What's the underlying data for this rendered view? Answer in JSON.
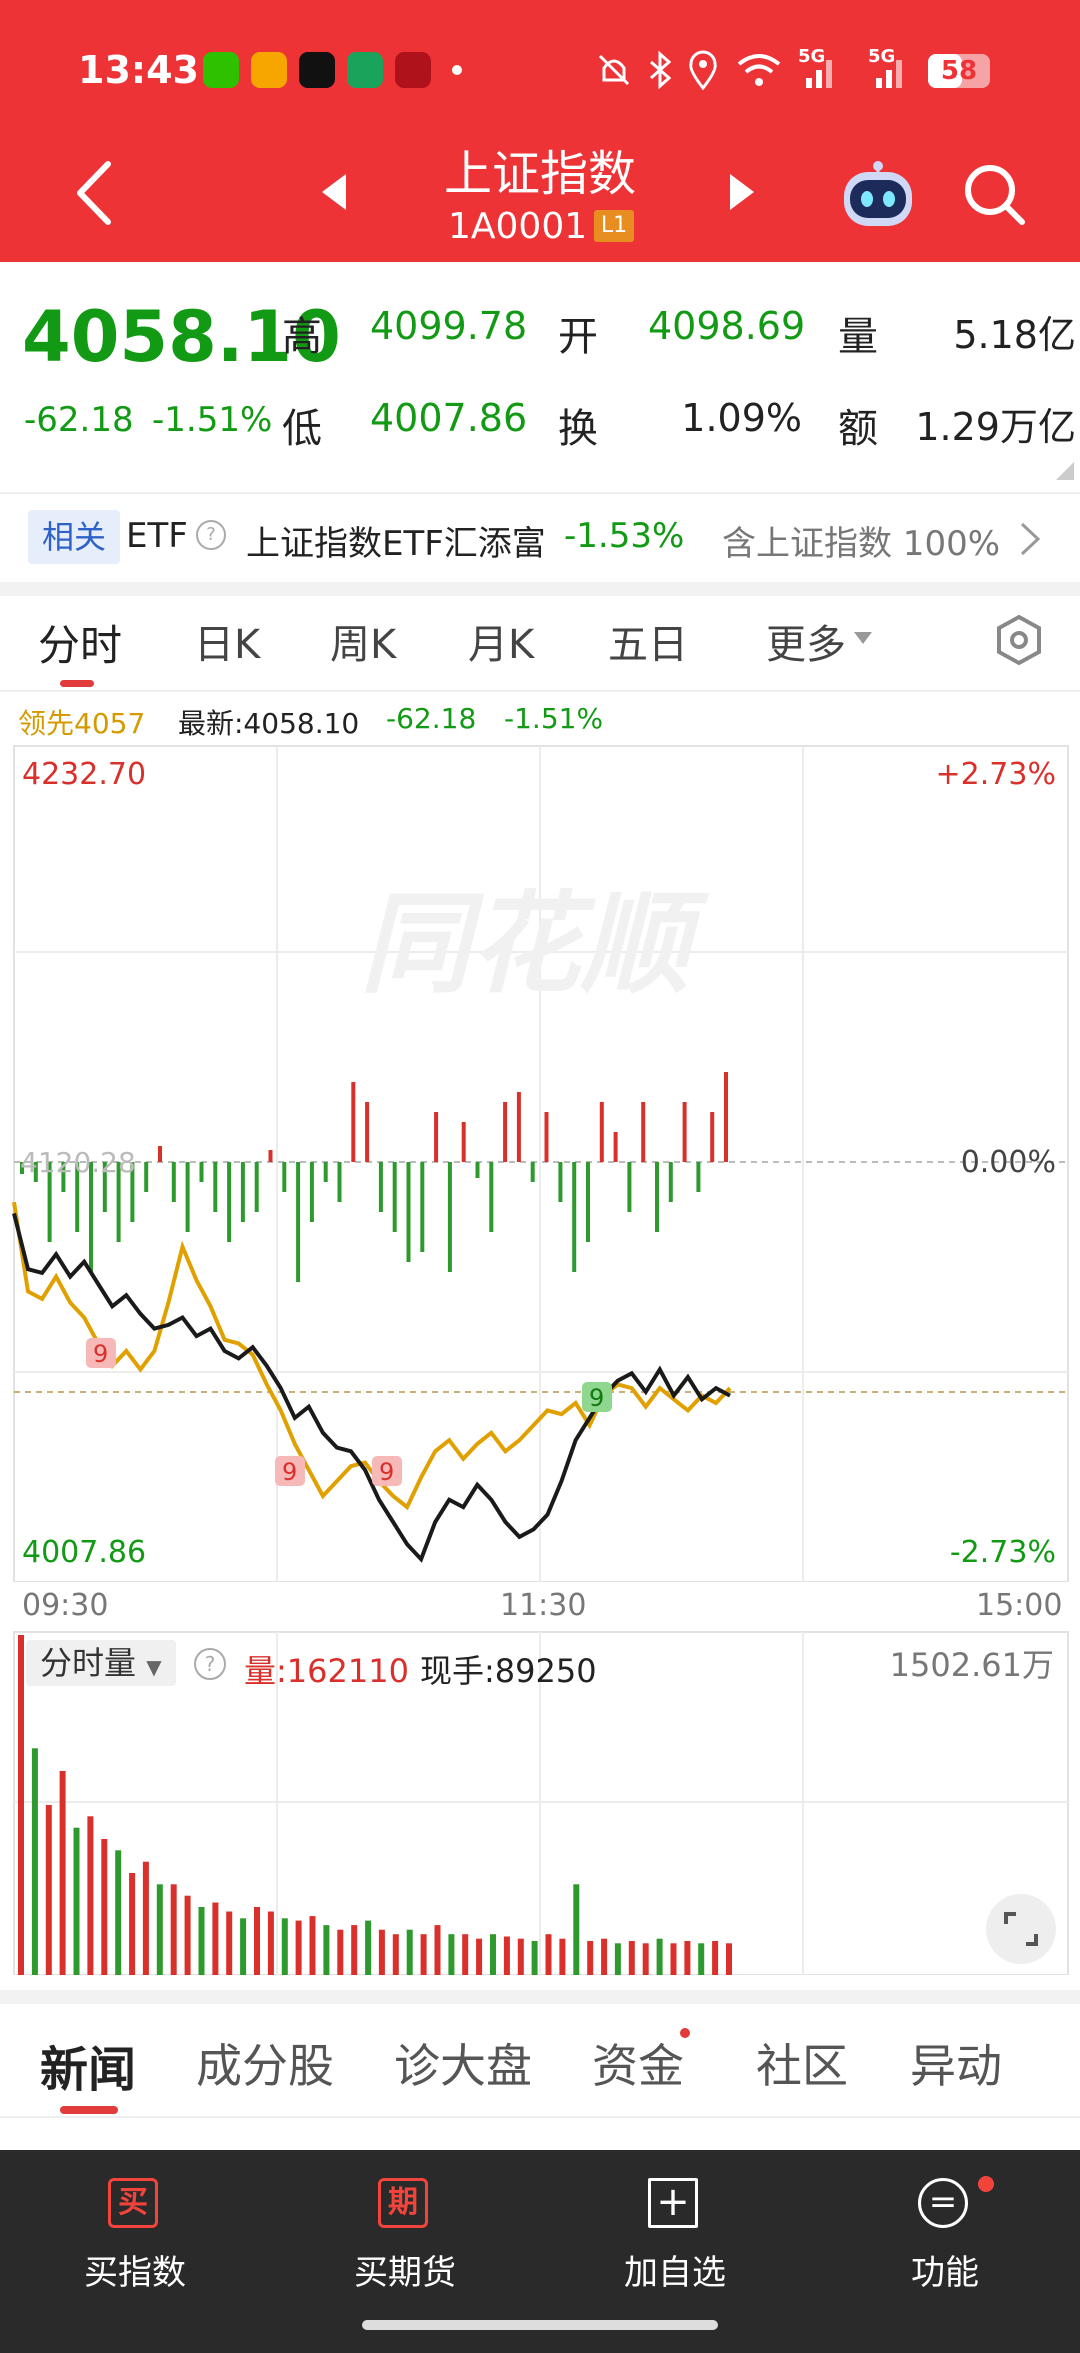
{
  "status_bar": {
    "time": "13:43",
    "app_icons": [
      "wechat-icon",
      "weibo-icon",
      "tiktok-icon",
      "app-green-icon",
      "bank-icon"
    ],
    "battery": "58",
    "signal_labels": [
      "5G",
      "5G"
    ]
  },
  "header": {
    "title": "上证指数",
    "code": "1A0001",
    "level_badge": "L1"
  },
  "quote": {
    "price": "4058.10",
    "change": "-62.18",
    "change_pct": "-1.51%",
    "high_label": "高",
    "high": "4099.78",
    "open_label": "开",
    "open": "4098.69",
    "volume_label": "量",
    "volume": "5.18亿",
    "low_label": "低",
    "low": "4007.86",
    "turnover_label": "换",
    "turnover": "1.09%",
    "amount_label": "额",
    "amount": "1.29万亿"
  },
  "related": {
    "tag": "相关",
    "type": "ETF",
    "fund_name": "上证指数ETF汇添富",
    "fund_change": "-1.53%",
    "holding_text": "含上证指数 100%"
  },
  "chart_tabs": [
    "分时",
    "日K",
    "周K",
    "月K",
    "五日",
    "更多"
  ],
  "chart_info": {
    "lead_label": "领先4057",
    "latest_label": "最新:4058.10",
    "change": "-62.18",
    "change_pct": "-1.51%"
  },
  "price_axis": {
    "top_value": "4232.70",
    "top_pct": "+2.73%",
    "mid_pct": "0.00%",
    "mid_value": "4120.28",
    "bottom_value": "4007.86",
    "bottom_pct": "-2.73%",
    "watermark": "同花顺",
    "time_start": "09:30",
    "time_mid": "11:30",
    "time_end": "15:00",
    "signal_marker": "9"
  },
  "volume_panel": {
    "selector": "分时量",
    "vol_label": "量:162110",
    "hand_label": "现手:89250",
    "max_label": "1502.61万"
  },
  "chart_data": {
    "type": "line",
    "xlabel": "",
    "ylabel": "",
    "ylim": [
      4007.86,
      4232.7
    ],
    "series": [
      {
        "values": [
          4107,
          4092,
          4091,
          4096,
          4090,
          4094,
          4088,
          4082,
          4085,
          4080,
          4076,
          4077,
          4079,
          4074,
          4076,
          4070,
          4068,
          4071,
          4066,
          4060,
          4052,
          4055,
          4048,
          4044,
          4043,
          4038,
          4030,
          4024,
          4018,
          4014,
          4024,
          4030,
          4028,
          4034,
          4030,
          4024,
          4020,
          4022,
          4026,
          4035,
          4046,
          4052,
          4058,
          4062,
          4064,
          4059,
          4065,
          4058,
          4063,
          4057,
          4060,
          4058
        ]
      },
      {
        "values": [
          4110,
          4086,
          4084,
          4090,
          4083,
          4079,
          4072,
          4066,
          4070,
          4065,
          4070,
          4083,
          4098,
          4089,
          4082,
          4073,
          4072,
          4069,
          4061,
          4054,
          4045,
          4038,
          4031,
          4035,
          4039,
          4040,
          4035,
          4031,
          4028,
          4036,
          4043,
          4046,
          4041,
          4045,
          4048,
          4043,
          4046,
          4050,
          4054,
          4053,
          4056,
          4050,
          4058,
          4061,
          4060,
          4055,
          4060,
          4057,
          4054,
          4058,
          4056,
          4060
        ]
      }
    ],
    "volume_bars": [
      150,
      100,
      75,
      90,
      65,
      70,
      60,
      55,
      45,
      50,
      40,
      40,
      35,
      30,
      32,
      28,
      25,
      30,
      28,
      25,
      24,
      26,
      22,
      20,
      22,
      24,
      20,
      18,
      20,
      18,
      22,
      18,
      18,
      16,
      18,
      17,
      16,
      15,
      18,
      16,
      40,
      15,
      16,
      14,
      15,
      14,
      16,
      14,
      15,
      14,
      15,
      14
    ],
    "net_bars": [
      -6,
      -10,
      -40,
      -15,
      -35,
      -55,
      -25,
      -40,
      -30,
      -15,
      8,
      -20,
      -35,
      -10,
      -25,
      -40,
      -30,
      -25,
      6,
      -15,
      -60,
      -30,
      -10,
      -20,
      40,
      30,
      -25,
      -35,
      -50,
      -45,
      25,
      -55,
      20,
      -8,
      -35,
      30,
      35,
      -10,
      25,
      -20,
      -55,
      -40,
      30,
      15,
      -25,
      30,
      -35,
      -20,
      30,
      -15,
      25,
      45
    ]
  },
  "news_tabs": [
    "新闻",
    "成分股",
    "诊大盘",
    "资金",
    "社区",
    "异动"
  ],
  "bottom_nav": [
    {
      "icon": "买",
      "label": "买指数"
    },
    {
      "icon": "期",
      "label": "买期货"
    },
    {
      "icon": "+",
      "label": "加自选"
    },
    {
      "icon": "=",
      "label": "功能"
    }
  ],
  "colors": {
    "accent": "#ee3337",
    "up": "#d9302c",
    "down": "#129a14",
    "line_black": "#1a1a1a",
    "line_gold": "#e0a000"
  }
}
